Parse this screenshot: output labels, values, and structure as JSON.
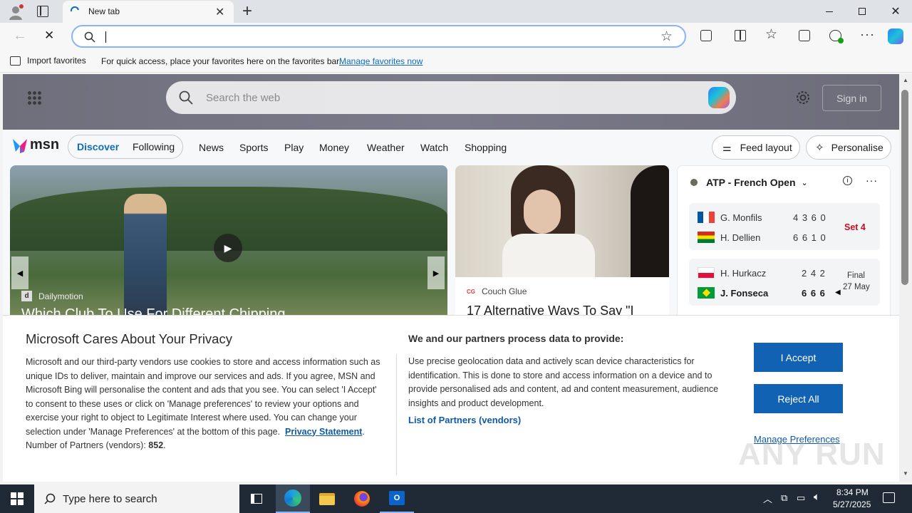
{
  "browser": {
    "tab_title": "New tab",
    "new_tab_symbol": "+",
    "favbar": {
      "import_label": "Import favorites",
      "hint": "For quick access, place your favorites here on the favorites bar.",
      "manage_link": "Manage favorites now"
    }
  },
  "msn": {
    "search_placeholder": "Search the web",
    "sign_in": "Sign in",
    "logo": "msn",
    "tabs": [
      "Discover",
      "Following"
    ],
    "nav": [
      "News",
      "Sports",
      "Play",
      "Money",
      "Weather",
      "Watch",
      "Shopping"
    ],
    "feed_layout": "Feed layout",
    "personalise": "Personalise",
    "video_card": {
      "source": "Dailymotion",
      "title": "Which Club To Use For Different Chipping..."
    },
    "article_card": {
      "source": "Couch Glue",
      "title": "17 Alternative Ways To Say \"I"
    },
    "sports": {
      "title": "ATP - French Open",
      "match1": {
        "p1": "G. Monfils",
        "p1_scores": "4 3 6 0",
        "p2": "H. Dellien",
        "p2_scores": "6 6 1 0",
        "status": "Set 4"
      },
      "match2": {
        "p1": "H. Hurkacz",
        "p1_scores": "2 4 2",
        "p2": "J. Fonseca",
        "p2_scores": "6 6 6",
        "status_line1": "Final",
        "status_line2": "27 May"
      }
    }
  },
  "privacy": {
    "title": "Microsoft Cares About Your Privacy",
    "body": "Microsoft and our third-party vendors use cookies to store and access information such as unique IDs to deliver, maintain and improve our services and ads. If you agree, MSN and Microsoft Bing will personalise the content and ads that you see. You can select 'I Accept' to consent to these uses or click on 'Manage preferences' to review your options and exercise your right to object to Legitimate Interest where used.  You can change your selection under 'Manage Preferences' at the bottom of this page.",
    "privacy_link": "Privacy Statement",
    "partners_label": "Number of Partners (vendors):",
    "partners_count": "852",
    "right_title": "We and our partners process data to provide:",
    "right_body": "Use precise geolocation data and actively scan device characteristics for identification. This is done to store and access information on a device and to provide personalised ads and content, ad and content measurement, audience insights and product development.",
    "partners_link": "List of Partners (vendors)",
    "accept": "I Accept",
    "reject": "Reject All",
    "manage": "Manage Preferences"
  },
  "taskbar": {
    "search_placeholder": "Type here to search",
    "time": "8:34 PM",
    "date": "5/27/2025"
  },
  "watermark": "ANY RUN",
  "colors": {
    "accent": "#1262b4",
    "link": "#0f6cbd",
    "taskbar": "#1f2a36"
  }
}
